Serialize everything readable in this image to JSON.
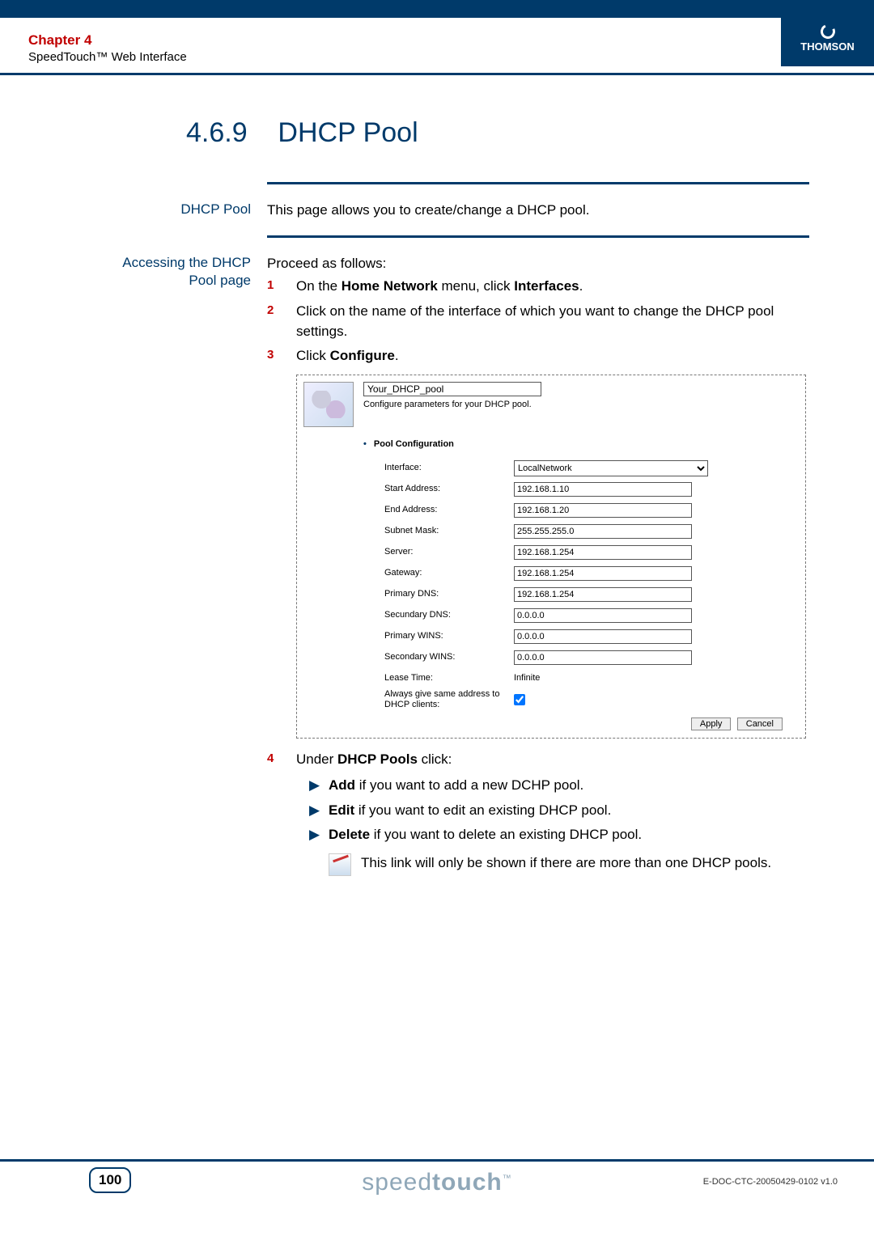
{
  "header": {
    "chapter": "Chapter 4",
    "subtitle": "SpeedTouch™ Web Interface",
    "brand": "THOMSON"
  },
  "section": {
    "number": "4.6.9",
    "title": "DHCP Pool"
  },
  "blocks": {
    "dhcp_pool": {
      "label": "DHCP Pool",
      "text": "This page allows you to create/change a DHCP pool."
    },
    "access": {
      "label": "Accessing the DHCP Pool page",
      "intro": "Proceed as follows:",
      "steps": [
        {
          "num": "1",
          "pre": "On the ",
          "bold1": "Home Network",
          "mid": " menu, click ",
          "bold2": "Interfaces",
          "post": "."
        },
        {
          "num": "2",
          "text": "Click on the name of the interface of which you want to change the DHCP pool settings."
        },
        {
          "num": "3",
          "pre": "Click ",
          "bold1": "Configure",
          "post": "."
        },
        {
          "num": "4",
          "pre": "Under ",
          "bold1": "DHCP Pools",
          "post": " click:"
        }
      ],
      "arrows": [
        {
          "bold": "Add",
          "text": " if you want to add a new DCHP pool."
        },
        {
          "bold": "Edit",
          "text": " if you want to edit an existing DHCP pool."
        },
        {
          "bold": "Delete",
          "text": " if you want to delete an existing DHCP pool."
        }
      ],
      "note": "This link will only be shown if there are more than one DHCP pools."
    }
  },
  "screenshot": {
    "title_input": "Your_DHCP_pool",
    "subtitle": "Configure parameters for your DHCP pool.",
    "section_head": "Pool Configuration",
    "fields": {
      "interface_label": "Interface:",
      "interface_value": "LocalNetwork",
      "start_label": "Start Address:",
      "start_value": "192.168.1.10",
      "end_label": "End Address:",
      "end_value": "192.168.1.20",
      "subnet_label": "Subnet Mask:",
      "subnet_value": "255.255.255.0",
      "server_label": "Server:",
      "server_value": "192.168.1.254",
      "gateway_label": "Gateway:",
      "gateway_value": "192.168.1.254",
      "pdns_label": "Primary DNS:",
      "pdns_value": "192.168.1.254",
      "sdns_label": "Secundary DNS:",
      "sdns_value": "0.0.0.0",
      "pwins_label": "Primary WINS:",
      "pwins_value": "0.0.0.0",
      "swins_label": "Secondary WINS:",
      "swins_value": "0.0.0.0",
      "lease_label": "Lease Time:",
      "lease_value": "Infinite",
      "same_addr_label": "Always give same address to DHCP clients:"
    },
    "buttons": {
      "apply": "Apply",
      "cancel": "Cancel"
    }
  },
  "footer": {
    "page": "100",
    "brand_light": "speed",
    "brand_bold": "touch",
    "tm": "™",
    "docid": "E-DOC-CTC-20050429-0102 v1.0"
  }
}
